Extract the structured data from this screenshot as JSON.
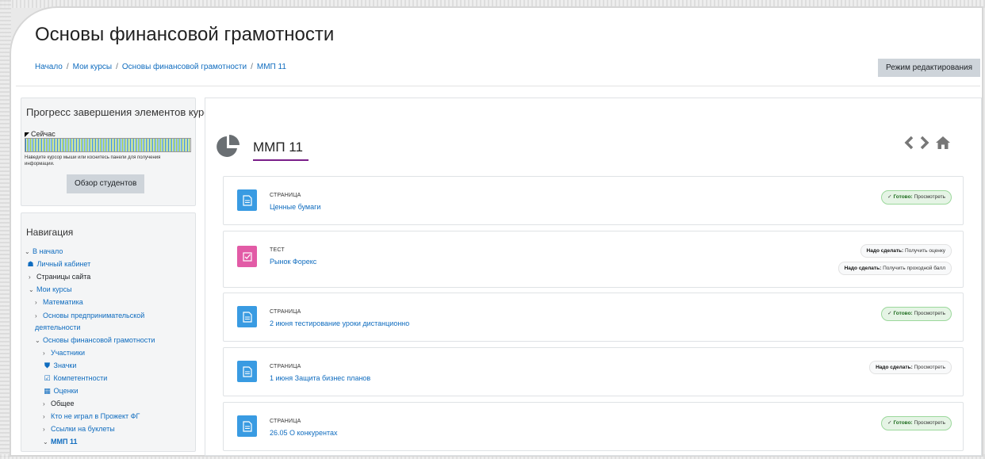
{
  "page": {
    "title": "Основы финансовой грамотности",
    "breadcrumb": [
      "Начало",
      "Мои курсы",
      "Основы финансовой грамотности",
      "ММП 11"
    ],
    "edit_mode_button": "Режим редактирования"
  },
  "progress_block": {
    "title": "Прогресс завершения элементов курса",
    "now_label": "Сейчас",
    "hint": "Наведите курсор мыши или коснитесь панели для получения информации.",
    "overview_button": "Обзор студентов"
  },
  "navigation": {
    "title": "Навигация",
    "items": [
      {
        "label": "В начало",
        "kind": "link",
        "prefix": "chevron-down"
      },
      {
        "label": "Личный кабинет",
        "kind": "link",
        "prefix": "dashboard-icon"
      },
      {
        "label": "Страницы сайта",
        "kind": "plain",
        "prefix": "chevron-right"
      },
      {
        "label": "Мои курсы",
        "kind": "link",
        "prefix": "chevron-down"
      },
      {
        "label": "Математика",
        "kind": "link",
        "prefix": "chevron-right"
      },
      {
        "label": "Основы предпринимательской деятельности",
        "kind": "link",
        "prefix": "chevron-right"
      },
      {
        "label": "Основы финансовой грамотности",
        "kind": "link",
        "prefix": "chevron-down"
      },
      {
        "label": "Участники",
        "kind": "link",
        "prefix": "chevron-right"
      },
      {
        "label": "Значки",
        "kind": "link",
        "prefix": "shield-icon"
      },
      {
        "label": "Компетентности",
        "kind": "link",
        "prefix": "checkbox-icon"
      },
      {
        "label": "Оценки",
        "kind": "link",
        "prefix": "table-icon"
      },
      {
        "label": "Общее",
        "kind": "plain",
        "prefix": "chevron-right"
      },
      {
        "label": "Кто не играл в Прожект ФГ",
        "kind": "link",
        "prefix": "chevron-right"
      },
      {
        "label": "Ссылки на буклеты",
        "kind": "link",
        "prefix": "chevron-right"
      },
      {
        "label": "ММП 11",
        "kind": "active",
        "prefix": "chevron-down"
      }
    ]
  },
  "section": {
    "title": "ММП 11",
    "icon": "pie-chart-icon",
    "accent_color": "#7a1f89"
  },
  "activities": [
    {
      "type": "Страница",
      "name": "Ценные бумаги",
      "icon": "page-icon",
      "status": [
        {
          "kind": "done",
          "label": "Готово:",
          "text": "Просмотреть"
        }
      ]
    },
    {
      "type": "Тест",
      "name": "Рынок Форекс",
      "icon": "quiz-icon",
      "status": [
        {
          "kind": "todo",
          "label": "Надо сделать:",
          "text": "Получить оценку"
        },
        {
          "kind": "todo",
          "label": "Надо сделать:",
          "text": "Получить проходной балл"
        }
      ]
    },
    {
      "type": "Страница",
      "name": "2 июня тестирование уроки дистанционно",
      "icon": "page-icon",
      "status": [
        {
          "kind": "done",
          "label": "Готово:",
          "text": "Просмотреть"
        }
      ]
    },
    {
      "type": "Страница",
      "name": "1 июня Защита бизнес планов",
      "icon": "page-icon",
      "status": [
        {
          "kind": "todo",
          "label": "Надо сделать:",
          "text": "Просмотреть"
        }
      ]
    },
    {
      "type": "Страница",
      "name": "26.05 О конкурентах",
      "icon": "page-icon",
      "status": [
        {
          "kind": "done",
          "label": "Готово:",
          "text": "Просмотреть"
        }
      ]
    }
  ],
  "colors": {
    "link": "#0f6cbf",
    "page_icon_bg": "#399be2",
    "quiz_icon_bg": "#e25ba6",
    "done_badge_bg": "#e5f4e5"
  }
}
